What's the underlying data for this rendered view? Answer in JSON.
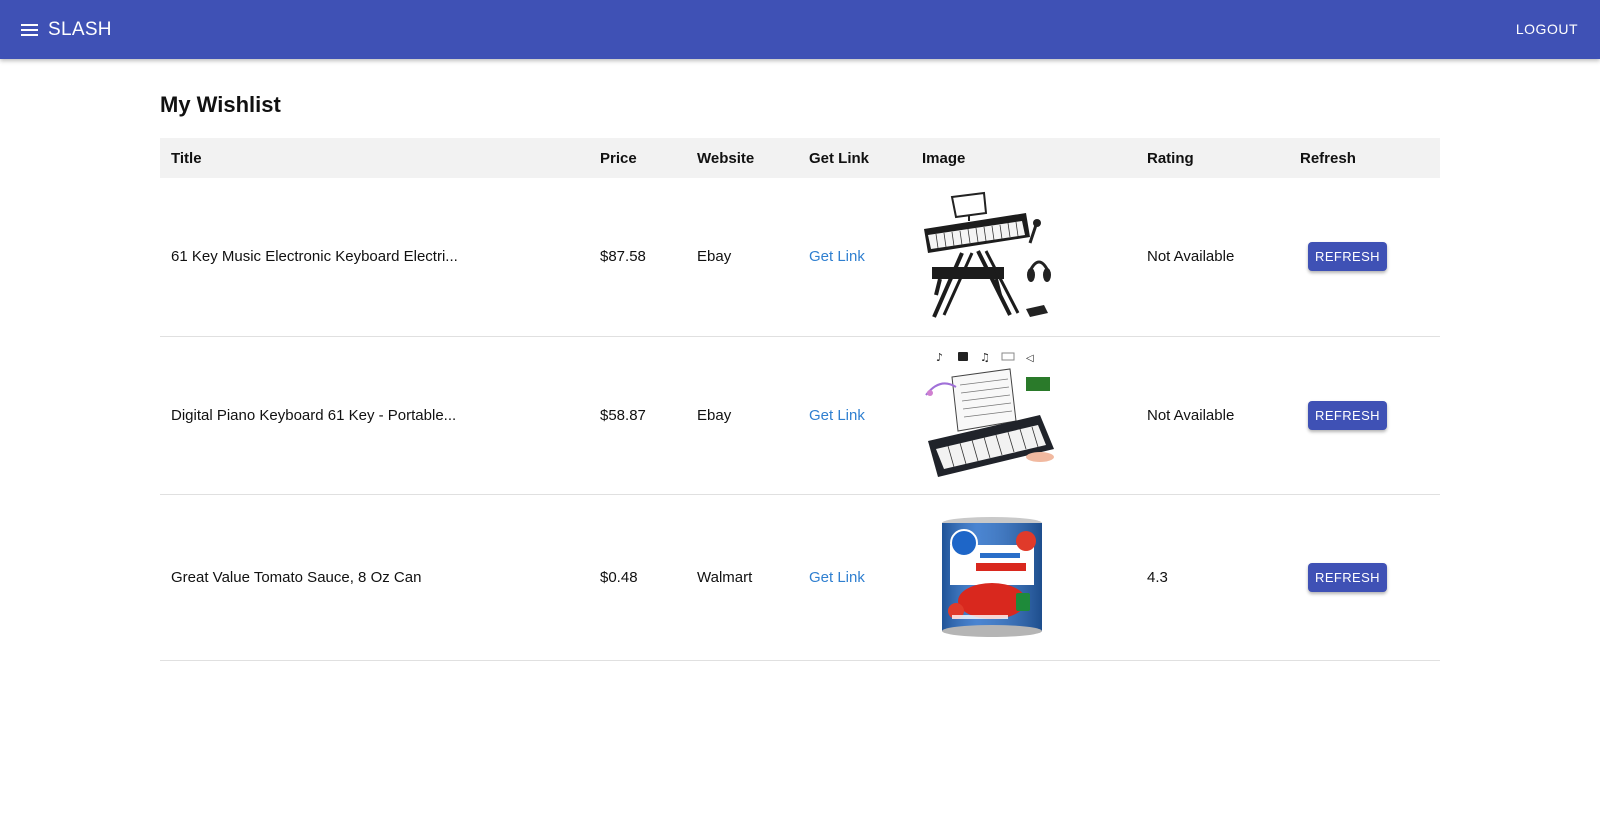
{
  "appbar": {
    "brand": "SLASH",
    "logout_label": "LOGOUT",
    "color": "#3f51b5"
  },
  "page": {
    "title": "My Wishlist"
  },
  "table": {
    "columns": [
      "Title",
      "Price",
      "Website",
      "Get Link",
      "Image",
      "Rating",
      "Refresh"
    ],
    "rows": [
      {
        "title": "61 Key Music Electronic Keyboard Electri...",
        "price": "$87.58",
        "website": "Ebay",
        "link_label": "Get Link",
        "image": "electronic-keyboard-with-stand-image",
        "rating": "Not Available",
        "refresh_label": "REFRESH"
      },
      {
        "title": "Digital Piano Keyboard 61 Key - Portable...",
        "price": "$58.87",
        "website": "Ebay",
        "link_label": "Get Link",
        "image": "portable-digital-piano-image",
        "rating": "Not Available",
        "refresh_label": "REFRESH"
      },
      {
        "title": "Great Value Tomato Sauce, 8 Oz Can",
        "price": "$0.48",
        "website": "Walmart",
        "link_label": "Get Link",
        "image": "tomato-sauce-can-image",
        "rating": "4.3",
        "refresh_label": "REFRESH"
      }
    ]
  }
}
